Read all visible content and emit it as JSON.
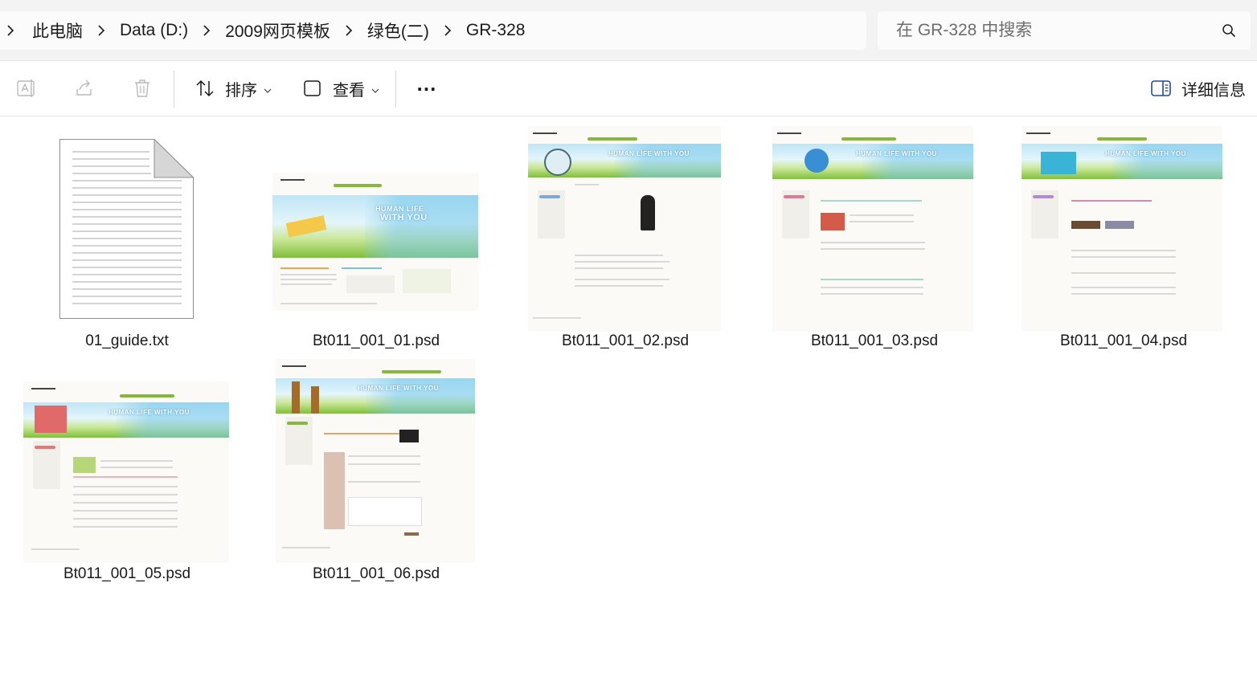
{
  "breadcrumb": {
    "items": [
      "此电脑",
      "Data (D:)",
      "2009网页模板",
      "绿色(二)",
      "GR-328"
    ]
  },
  "search": {
    "placeholder": "在 GR-328 中搜索"
  },
  "toolbar": {
    "sort_label": "排序",
    "view_label": "查看",
    "more_label": "…",
    "details_label": "详细信息"
  },
  "files": [
    {
      "name": "01_guide.txt",
      "type": "text"
    },
    {
      "name": "Bt011_001_01.psd",
      "type": "psd"
    },
    {
      "name": "Bt011_001_02.psd",
      "type": "psd"
    },
    {
      "name": "Bt011_001_03.psd",
      "type": "psd"
    },
    {
      "name": "Bt011_001_04.psd",
      "type": "psd"
    },
    {
      "name": "Bt011_001_05.psd",
      "type": "psd"
    },
    {
      "name": "Bt011_001_06.psd",
      "type": "psd"
    }
  ],
  "thumbnails": {
    "headline": "HUMAN LIFE WITH YOU",
    "headline_split": [
      "HUMAN LIFE",
      "WITH YOU"
    ]
  },
  "colors": {
    "accent": "#86b93b",
    "sky": "#bfe6f7"
  },
  "icons": {
    "breadcrumb_separator": "chevron-right-icon",
    "search": "search-icon",
    "rename": "rename-icon",
    "share": "share-icon",
    "delete": "trash-icon",
    "sort": "sort-icon",
    "view": "view-icon",
    "details": "details-pane-icon"
  }
}
